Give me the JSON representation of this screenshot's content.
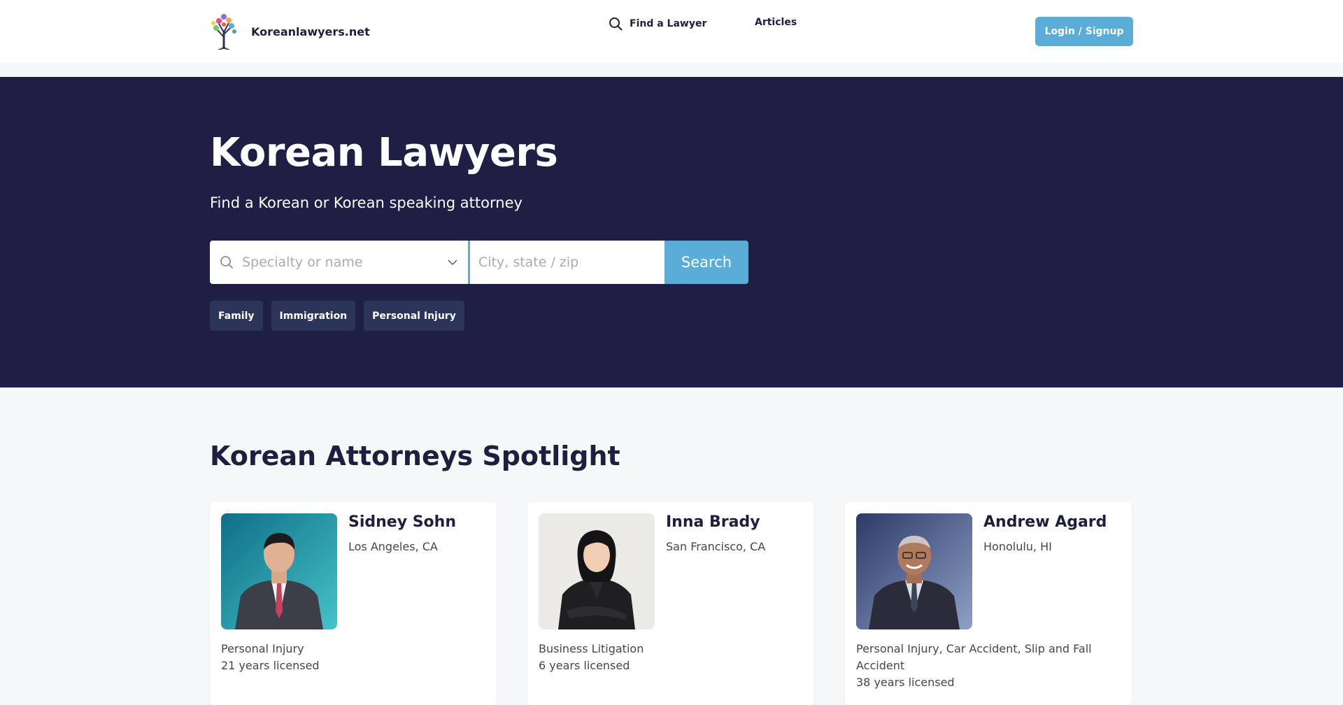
{
  "header": {
    "brand_name": "Koreanlawyers.net",
    "nav": {
      "find_lawyer": "Find a Lawyer",
      "articles": "Articles"
    },
    "login_label": "Login / Signup"
  },
  "hero": {
    "title": "Korean Lawyers",
    "subtitle": "Find a Korean or Korean speaking attorney",
    "search": {
      "specialty_placeholder": "Specialty or name",
      "location_placeholder": "City, state / zip",
      "button_label": "Search"
    },
    "chips": [
      "Family",
      "Immigration",
      "Personal Injury"
    ]
  },
  "spotlight": {
    "title": "Korean Attorneys Spotlight",
    "attorneys": [
      {
        "name": "Sidney Sohn",
        "location": "Los Angeles, CA",
        "practice": "Personal Injury",
        "licensed": "21 years licensed"
      },
      {
        "name": "Inna Brady",
        "location": "San Francisco, CA",
        "practice": "Business Litigation",
        "licensed": "6 years licensed"
      },
      {
        "name": "Andrew Agard",
        "location": "Honolulu, HI",
        "practice": "Personal Injury, Car Accident, Slip and Fall Accident",
        "licensed": "38 years licensed"
      }
    ]
  },
  "colors": {
    "navy": "#1f1f45",
    "accent": "#5aadd6",
    "chip": "#2c3459",
    "page_bg": "#f6f7f9"
  },
  "icons": {
    "logo": "tree-logo",
    "search": "search-icon",
    "dropdown": "chevron-down-icon"
  }
}
